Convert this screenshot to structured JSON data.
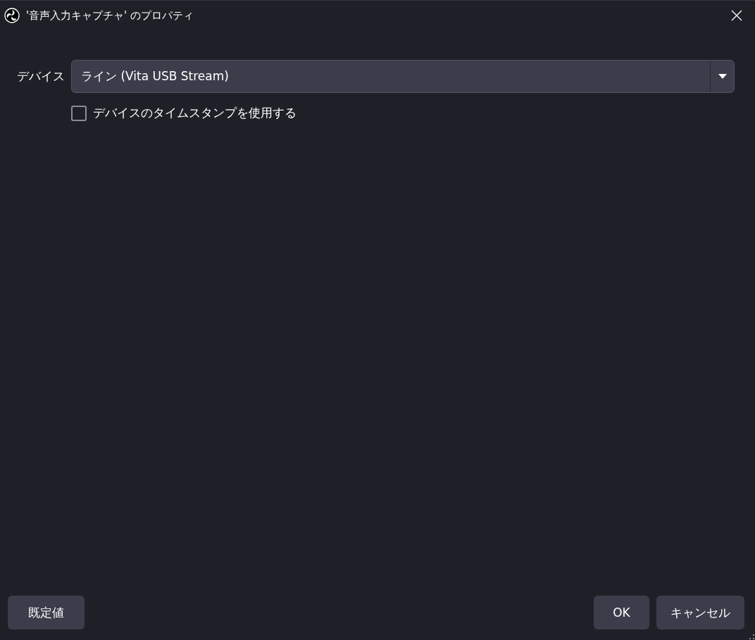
{
  "window": {
    "title": "'音声入力キャプチャ' のプロパティ"
  },
  "properties": [
    {
      "kind": "dropdown",
      "label": "デバイス",
      "value": "ライン (Vita USB Stream)"
    },
    {
      "kind": "checkbox",
      "label": "デバイスのタイムスタンプを使用する",
      "checked": false
    }
  ],
  "buttons_left": [
    {
      "label": "既定値"
    }
  ],
  "buttons_right": [
    {
      "label": "OK"
    },
    {
      "label": "キャンセル"
    }
  ]
}
